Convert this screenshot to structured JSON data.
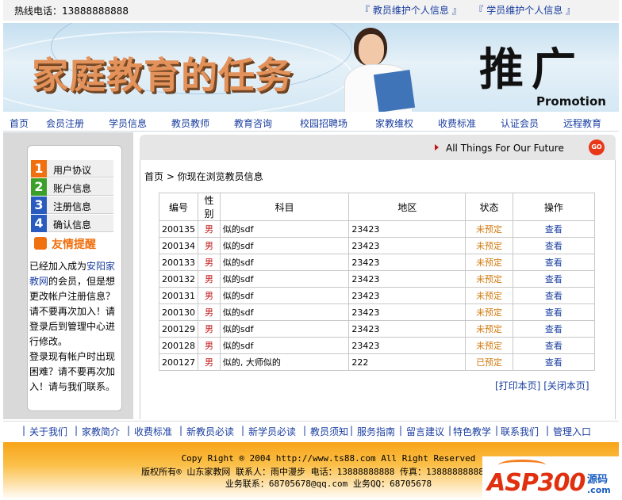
{
  "top": {
    "hotline": "热线电话：13888888888",
    "links": [
      "『 教员维护个人信息 』",
      "『 学员维护个人信息 』"
    ]
  },
  "banner": {
    "title": "家庭教育的任务",
    "calligraphy": "推广",
    "promotion": "Promotion"
  },
  "nav": [
    "首页",
    "会员注册",
    "学员信息",
    "教员教师",
    "教育咨询",
    "校园招聘场",
    "家教维权",
    "收费标准",
    "认证会员",
    "远程教育"
  ],
  "sidebar": {
    "items": [
      {
        "num": "1",
        "label": "用户协议",
        "color": "#f07010"
      },
      {
        "num": "2",
        "label": "账户信息",
        "color": "#3aa02a"
      },
      {
        "num": "3",
        "label": "注册信息",
        "color": "#2a5cc0"
      },
      {
        "num": "4",
        "label": "确认信息",
        "color": "#2a5cc0"
      }
    ],
    "remind_title": "友情提醒",
    "text_before": "已经加入成为",
    "text_highlight": "安阳家教网",
    "text_after": "的会员，但是想更改帐户注册信息？请不要再次加入！请登录后到管理中心进行修改。",
    "text2": "登录现有帐户时出现困难？请不要再次加入！请与我们联系。"
  },
  "main": {
    "slogan": "All Things For Our Future",
    "go_label": "GO",
    "breadcrumb": "首页 > 你现在浏览教员信息",
    "table": {
      "headers": [
        "编号",
        "性别",
        "科目",
        "地区",
        "状态",
        "操作"
      ],
      "rows": [
        [
          "200135",
          "男",
          "似的sdf",
          "23423",
          "未预定",
          "查看"
        ],
        [
          "200134",
          "男",
          "似的sdf",
          "23423",
          "未预定",
          "查看"
        ],
        [
          "200133",
          "男",
          "似的sdf",
          "23423",
          "未预定",
          "查看"
        ],
        [
          "200132",
          "男",
          "似的sdf",
          "23423",
          "未预定",
          "查看"
        ],
        [
          "200131",
          "男",
          "似的sdf",
          "23423",
          "未预定",
          "查看"
        ],
        [
          "200130",
          "男",
          "似的sdf",
          "23423",
          "未预定",
          "查看"
        ],
        [
          "200129",
          "男",
          "似的sdf",
          "23423",
          "未预定",
          "查看"
        ],
        [
          "200128",
          "男",
          "似的sdf",
          "23423",
          "未预定",
          "查看"
        ],
        [
          "200127",
          "男",
          "似的, 大师似的",
          "222",
          "已预定",
          "查看"
        ]
      ]
    },
    "print": "[打印本页]",
    "close": "[关闭本页]"
  },
  "footer_nav": [
    "关于我们",
    "家教简介",
    "收费标准",
    "新教员必读",
    "新学员必读",
    "教员须知",
    "服务指南",
    "留言建议",
    "特色教学",
    "联系我们",
    "管理入口"
  ],
  "footer": {
    "line1": "Copy Right ® 2004 http://www.ts88.com All Right Reserved",
    "line2": "版权所有® 山东家教网 联系人：雨中漫步 电话：13888888888 传真：13888888888",
    "line3": "业务联系：68705678@qq.com  业务QQ：68705678"
  },
  "watermark": {
    "asp": "ASP300",
    "src": "源码",
    "com": ".com"
  }
}
